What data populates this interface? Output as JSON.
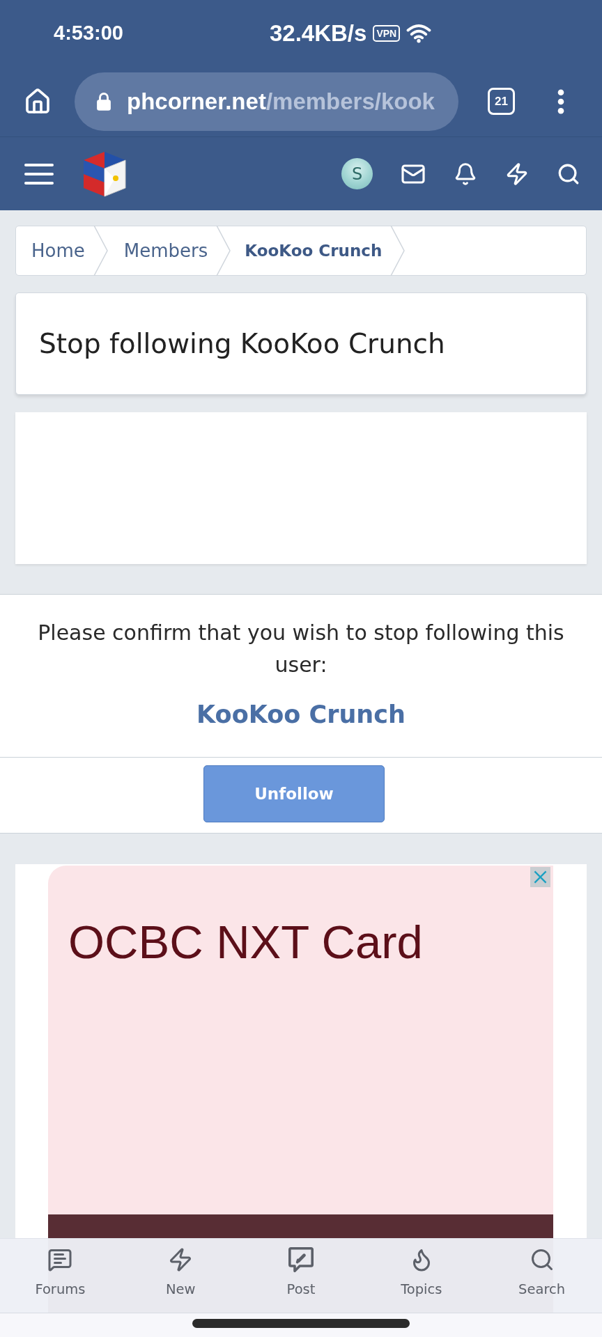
{
  "status_bar": {
    "time": "4:53:00",
    "network_speed": "32.4KB/s",
    "vpn_badge": "VPN"
  },
  "browser_bar": {
    "url_domain": "phcorner.net",
    "url_path": "/members/kook",
    "tab_count": "21"
  },
  "site_header": {
    "avatar_letter": "S"
  },
  "breadcrumbs": [
    {
      "label": "Home",
      "current": false
    },
    {
      "label": "Members",
      "current": false
    },
    {
      "label": "KooKoo Crunch",
      "current": true
    }
  ],
  "page_title": "Stop following KooKoo Crunch",
  "confirm": {
    "message": "Please confirm that you wish to stop following this user:",
    "username": "KooKoo Crunch",
    "button": "Unfollow"
  },
  "ad": {
    "headline": "OCBC NXT Card"
  },
  "bottom_nav": [
    {
      "kind": "forums",
      "label": "Forums"
    },
    {
      "kind": "new",
      "label": "New"
    },
    {
      "kind": "post",
      "label": "Post"
    },
    {
      "kind": "topics",
      "label": "Topics"
    },
    {
      "kind": "search",
      "label": "Search"
    }
  ]
}
